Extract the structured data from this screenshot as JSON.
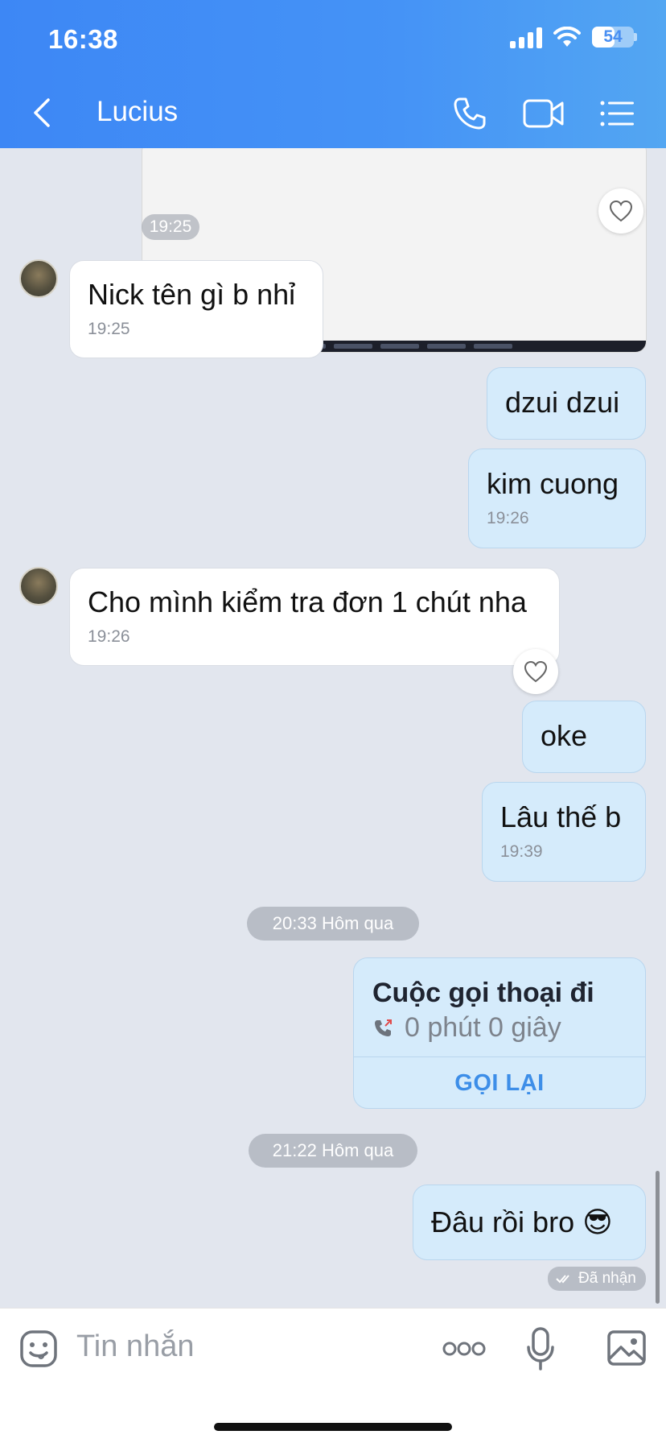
{
  "status_bar": {
    "time": "16:38",
    "battery": "54",
    "battery_level": 0.54
  },
  "header": {
    "contact_name": "Lucius"
  },
  "messages": {
    "image_time": "19:25",
    "m1": {
      "text": "Nick tên gì b nhỉ",
      "time": "19:25"
    },
    "m2": {
      "text": "dzui dzui"
    },
    "m3": {
      "text": "kim cuong",
      "time": "19:26"
    },
    "m4": {
      "text": "Cho mình kiểm tra đơn 1 chút nha",
      "time": "19:26"
    },
    "m5": {
      "text": "oke"
    },
    "m6": {
      "text": "Lâu thế b",
      "time": "19:39"
    },
    "divider1": "20:33 Hôm qua",
    "call": {
      "title": "Cuộc gọi thoại đi",
      "duration": "0 phút 0 giây",
      "action": "GỌI LẠI"
    },
    "divider2": "21:22 Hôm qua",
    "m7": {
      "text": "Đâu rồi bro 😎"
    },
    "status": "Đã nhận"
  },
  "input": {
    "placeholder": "Tin nhắn"
  },
  "colors": {
    "header_start": "#3d87f5",
    "header_end": "#53a6f2",
    "outgoing_bubble": "#d5ebfb",
    "chat_background": "#e2e6ee",
    "accent": "#3d8ee8"
  }
}
